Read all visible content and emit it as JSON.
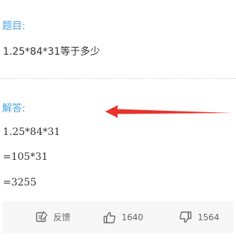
{
  "question": {
    "label": "题目:",
    "text": "1.25*84*31等于多少"
  },
  "answer": {
    "label": "解答:",
    "lines": [
      "1.25*84*31",
      "=105*31",
      "=3255"
    ]
  },
  "footer": {
    "feedback_label": "反馈",
    "like_count": "1640",
    "dislike_count": "1564"
  },
  "colors": {
    "accent": "#4aa3df",
    "arrow": "#e8322b",
    "text": "#333333",
    "footer_bg": "#f7f7f7"
  }
}
